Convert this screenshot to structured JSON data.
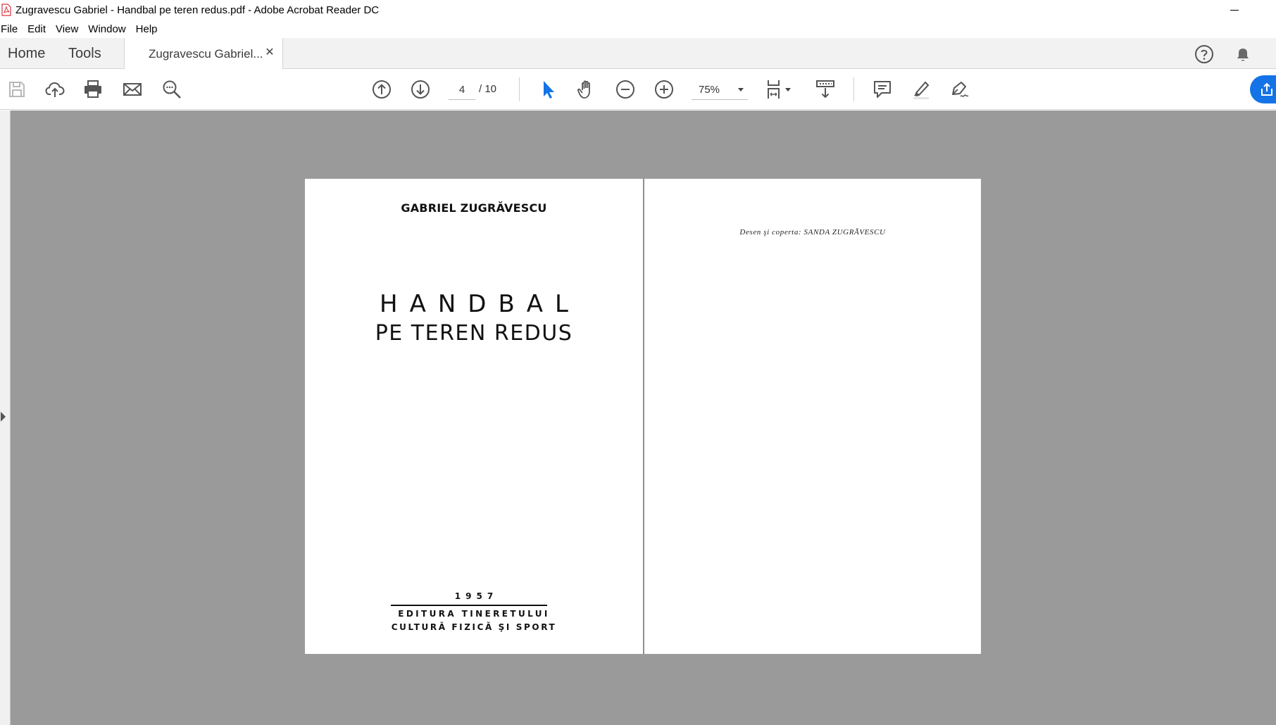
{
  "window": {
    "title": "Zugravescu Gabriel - Handbal pe teren redus.pdf - Adobe Acrobat Reader DC"
  },
  "menu": [
    "File",
    "Edit",
    "View",
    "Window",
    "Help"
  ],
  "tabs": {
    "home": "Home",
    "tools": "Tools",
    "document": "Zugravescu Gabriel..."
  },
  "toolbar": {
    "current_page": "4",
    "total_pages": "/ 10",
    "zoom": "75%"
  },
  "icons": {
    "save": "save-icon",
    "upload": "cloud-upload-icon",
    "print": "print-icon",
    "email": "mail-icon",
    "search": "search-icon",
    "prev_page": "arrow-up-circle-icon",
    "next_page": "arrow-down-circle-icon",
    "select": "pointer-icon",
    "hand": "hand-icon",
    "zoom_out": "minus-circle-icon",
    "zoom_in": "plus-circle-icon",
    "fit_page": "fit-page-icon",
    "scroll_mode": "scroll-mode-icon",
    "comment": "comment-icon",
    "highlight": "highlighter-icon",
    "sign": "sign-pen-icon",
    "help": "help-icon",
    "notifications": "bell-icon",
    "share": "share-icon"
  },
  "colors": {
    "accent": "#1473e6",
    "select_tool": "#1473e6",
    "doc_background": "#9a9a9a",
    "pdf_icon": "#d7373f"
  },
  "document": {
    "left_page": {
      "author": "GABRIEL ZUGRĂVESCU",
      "title_line1": "HANDBAL",
      "title_line2": "PE TEREN REDUS",
      "year": "1957",
      "publisher_line1": "EDITURA TINERETULUI",
      "publisher_line2": "CULTURĂ FIZICĂ ŞI SPORT"
    },
    "right_page": {
      "credit": "Desen şi coperta: SANDA ZUGRĂVESCU"
    }
  }
}
